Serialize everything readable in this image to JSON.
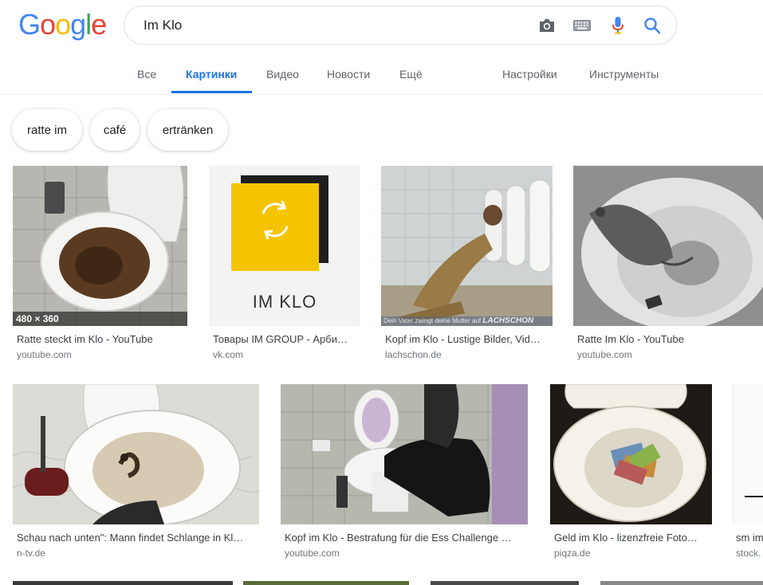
{
  "logo": {
    "letters": [
      "G",
      "o",
      "o",
      "g",
      "l",
      "e"
    ]
  },
  "search": {
    "query": "Im Klo",
    "icons": [
      "camera-icon",
      "keyboard-icon",
      "microphone-icon",
      "search-icon"
    ]
  },
  "tabs": {
    "items": [
      {
        "label": "Все"
      },
      {
        "label": "Картинки"
      },
      {
        "label": "Видео"
      },
      {
        "label": "Новости"
      },
      {
        "label": "Ещё"
      }
    ],
    "active": "Картинки",
    "settings": "Настройки",
    "tools": "Инструменты"
  },
  "chips": [
    "ratte im",
    "café",
    "ertränken"
  ],
  "results": [
    {
      "title": "Ratte steckt im Klo - YouTube",
      "source": "youtube.com",
      "dimensions": "480 × 360"
    },
    {
      "title": "Товары IM GROUP - Арби…",
      "source": "vk.com",
      "image_text": "IM KLO"
    },
    {
      "title": "Kopf im Klo - Lustige Bilder, Vid…",
      "source": "lachschon.de",
      "image_caption": "Dein Vater zwingt deine Mutter auf",
      "image_watermark": "LACHSCHON"
    },
    {
      "title": "Ratte Im Klo - YouTube",
      "source": "youtube.com"
    },
    {
      "title": "Schau nach unten\": Mann findet Schlange in Kl…",
      "source": "n-tv.de"
    },
    {
      "title": "Kopf im Klo - Bestrafung für die Ess Challenge …",
      "source": "youtube.com"
    },
    {
      "title": "Geld im Klo - lizenzfreie Foto…",
      "source": "piqza.de"
    },
    {
      "title": "sm im",
      "source": "stock."
    }
  ],
  "colors": {
    "accent_blue": "#1a73e8",
    "tab_text": "#5f6368",
    "source_text": "#70757a",
    "title_text": "#3c4043"
  }
}
